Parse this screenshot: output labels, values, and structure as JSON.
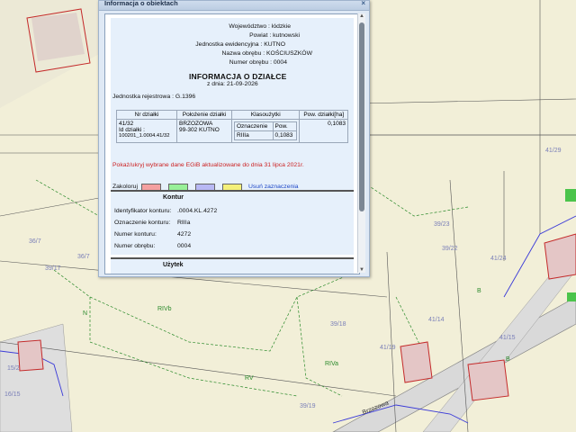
{
  "popup": {
    "title": "Informacja o obiektach",
    "close": "×"
  },
  "header_fields": {
    "wojewodztwo": "Województwo : łódzkie",
    "powiat": "Powiat : kutnowski",
    "jednostka": "Jednostka ewidencyjna : KUTNO",
    "obreb_name": "Nazwa obrębu : KOŚCIUSZKÓW",
    "obreb_num": "Numer obrębu : 0004"
  },
  "report": {
    "heading": "INFORMACJA O DZIAŁCE",
    "date": "z dnia: 21-09-2026",
    "register": "Jednostka rejestrowa : G.1396"
  },
  "plot_table": {
    "headers": [
      "Nr działki",
      "Położenie działki",
      "Klasoużytki",
      "Pow. działki[ha]"
    ],
    "nr": "41/32",
    "id_label": "Id działki :",
    "id_value": "100201_1.0004.41/32",
    "location_line1": "BRZOZOWA",
    "location_line2": "99-302 KUTNO",
    "class_header_1": "Oznaczenie",
    "class_header_2": "Pow.",
    "class_value": "RIIIa",
    "class_area": "0,1083",
    "area": "0,1083"
  },
  "notice": "Pokaż/ukryj wybrane dane EGiB aktualizowane do dnia 31 lipca 2021r.",
  "colorize": {
    "label": "Zakoloruj",
    "colors": [
      "#f4a0a0",
      "#98f098",
      "#b8b8f4",
      "#f4f07a"
    ],
    "clear": "Usuń zaznaczenia"
  },
  "kontur": {
    "title": "Kontur",
    "rows": [
      {
        "label": "Identyfikator konturu:",
        "value": ".0004.KL.4272"
      },
      {
        "label": "Oznaczenie konturu:",
        "value": "RIIIa"
      },
      {
        "label": "Numer konturu:",
        "value": "4272"
      },
      {
        "label": "Numer obrębu:",
        "value": "0004"
      }
    ]
  },
  "uzytek": {
    "title": "Użytek"
  },
  "map": {
    "labels": {
      "l1": "41/29",
      "l2": "39/23",
      "l3": "39/22",
      "l4": "41/24",
      "l5": "39/17",
      "l6": "36/7",
      "l7": "36/7",
      "l8": "RIVb",
      "l9": "RV",
      "l10": "39/19",
      "l11": "41/14",
      "l12": "41/15",
      "l13": "39/18",
      "l14": "RIVa",
      "l15": "41/19",
      "l16": "Brzozowa",
      "l17": "15/2",
      "l18": "16/15",
      "l19": "B",
      "l20": "B",
      "l21": "N"
    }
  }
}
